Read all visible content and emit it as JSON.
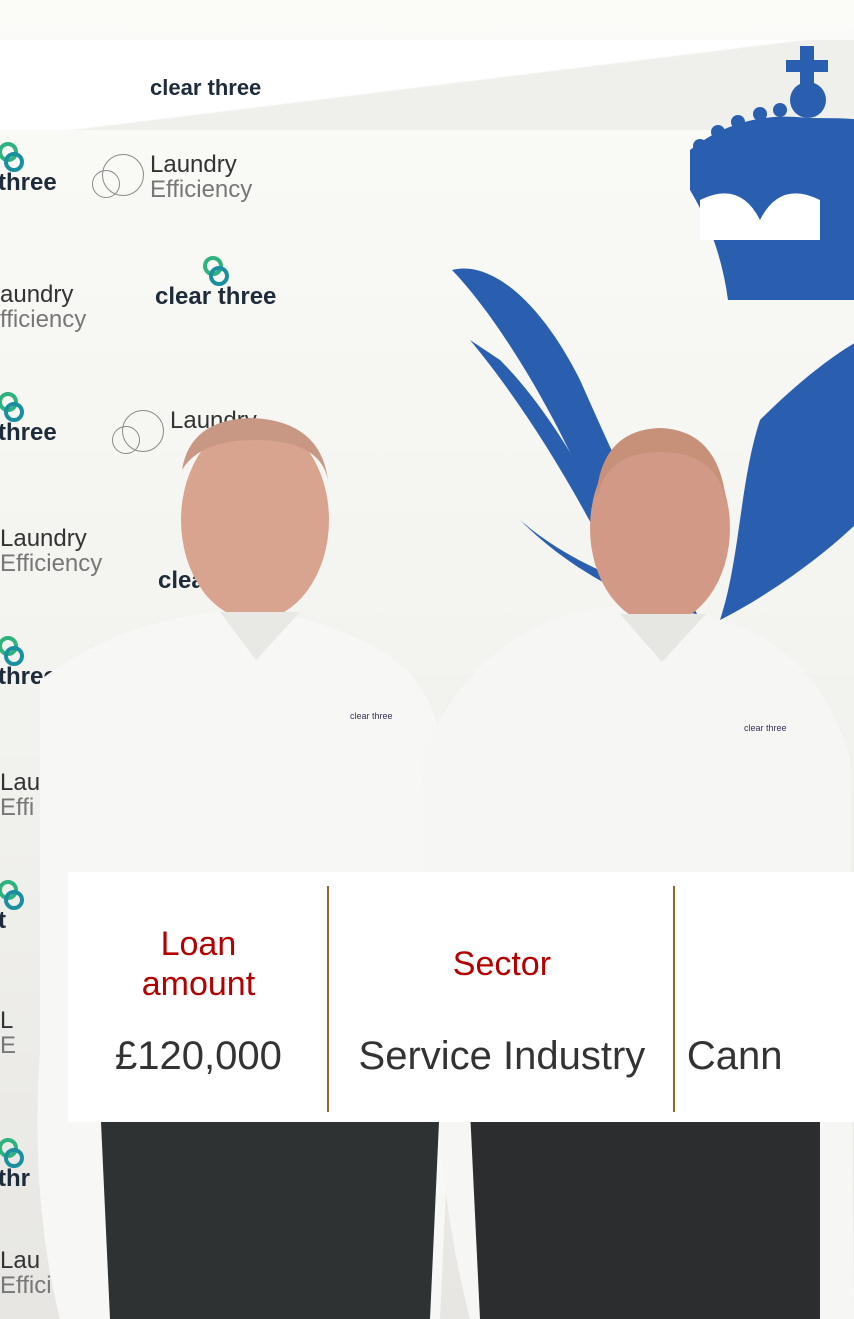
{
  "logos": {
    "clear_three": "clear three",
    "clear_three_partial_top": "clear three",
    "three": "three",
    "laundry_word": "Laundry",
    "efficiency_word": "Efficiency",
    "laundry_partial": "aundry",
    "efficiency_partial": "fficiency",
    "laundry_short": "Lau",
    "efficiency_short": "Effi",
    "laundry_partial_lower": "Lau",
    "efficiency_partial_lower": "Effici",
    "thr": "thr",
    "clea": "clea",
    "t": "t",
    "l": "L",
    "e": "E"
  },
  "shirt_logo": "clear three",
  "emblem_color": "#2a5fb0",
  "info": {
    "loan_label": "Loan amount",
    "loan_value": "£120,000",
    "sector_label": "Sector",
    "sector_value": "Service Industry",
    "third_value": "Cann"
  },
  "colors": {
    "label": "#b30000",
    "divider": "#8b6a2c",
    "value": "#333333"
  }
}
